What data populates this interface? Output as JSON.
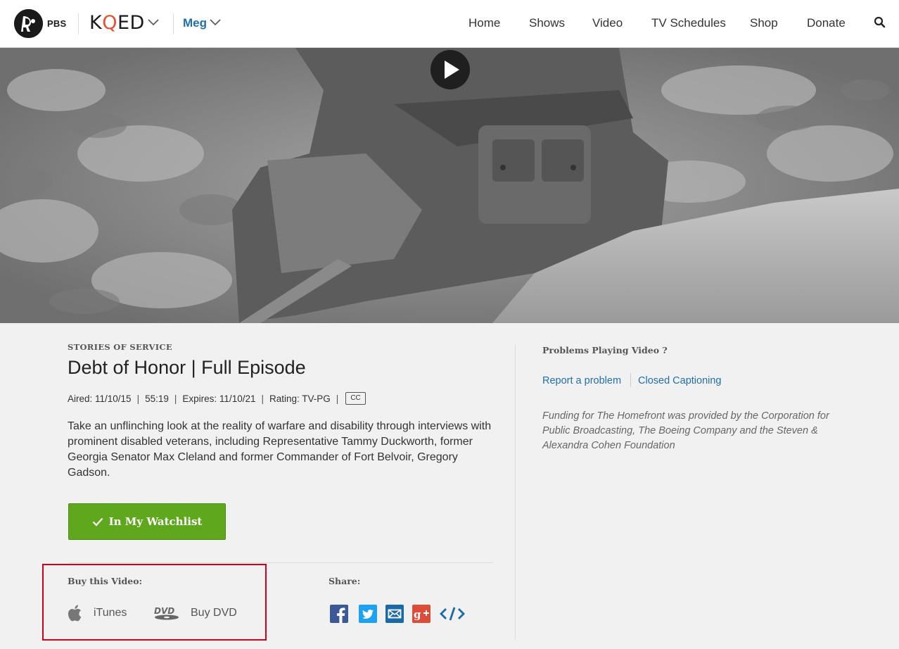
{
  "header": {
    "pbs_logo_text": "PBS",
    "station_prefix": "K",
    "station_q": "Q",
    "station_suffix": "ED",
    "user_name": "Meg",
    "nav": [
      {
        "label": "Home"
      },
      {
        "label": "Shows"
      },
      {
        "label": "Video"
      },
      {
        "label": "TV Schedules"
      },
      {
        "label": "Shop"
      },
      {
        "label": "Donate"
      }
    ]
  },
  "video": {
    "show": "STORIES OF SERVICE",
    "title": "Debt of Honor | Full Episode",
    "meta": {
      "aired": "Aired: 11/10/15",
      "duration": "55:19",
      "expires": "Expires: 11/10/21",
      "rating": "Rating: TV-PG",
      "cc_badge": "CC",
      "separator": "|"
    },
    "description": "Take an unflinching look at the reality of warfare and disability through interviews with prominent disabled veterans, including Representative Tammy Duckworth, former Georgia Senator Max Cleland and former Commander of Fort Belvoir, Gregory Gadson.",
    "watchlist_label": "In My Watchlist"
  },
  "buy": {
    "label": "Buy this Video:",
    "itunes": "iTunes",
    "dvd": "Buy DVD"
  },
  "share": {
    "label": "Share:",
    "icons": [
      "facebook-icon",
      "twitter-icon",
      "email-icon",
      "google-plus-icon",
      "embed-icon"
    ]
  },
  "sidebar": {
    "problems_title": "Problems Playing Video ?",
    "report_link": "Report a problem",
    "cc_link": "Closed Captioning",
    "funding": "Funding for The Homefront was provided by the Corporation for Public Broadcasting, The Boeing Company and the Steven & Alexandra Cohen Foundation"
  },
  "colors": {
    "accent_blue": "#1f6fae",
    "watchlist_green": "#5fa81d",
    "kqed_orange": "#e6512b",
    "highlight_red": "#d0021b",
    "facebook": "#3b5998",
    "twitter": "#1da1f2",
    "email": "#1b6aa5",
    "google_plus": "#dd4b39"
  }
}
